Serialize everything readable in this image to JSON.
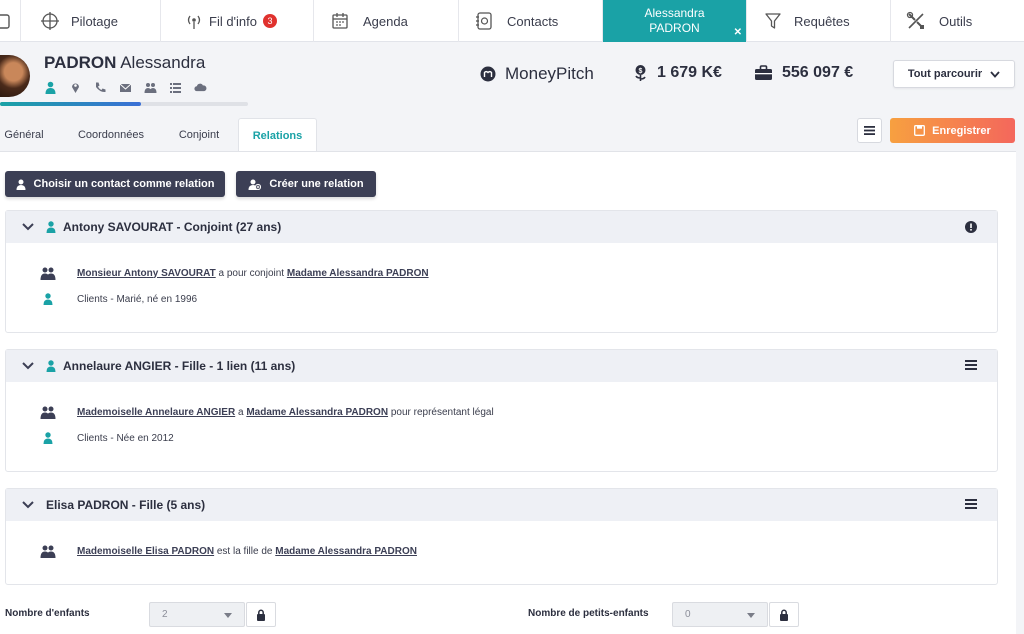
{
  "nav": {
    "items": [
      {
        "label": "Pilotage",
        "icon": "crosshair-icon"
      },
      {
        "label": "Fil d'info",
        "icon": "broadcast-icon",
        "badge": "3"
      },
      {
        "label": "Agenda",
        "icon": "calendar-icon"
      },
      {
        "label": "Contacts",
        "icon": "address-book-icon"
      },
      {
        "label_line1": "Alessandra",
        "label_line2": "PADRON",
        "active": true
      },
      {
        "label": "Requêtes",
        "icon": "filter-icon"
      },
      {
        "label": "Outils",
        "icon": "tools-icon"
      }
    ]
  },
  "profile": {
    "last_name": "PADRON",
    "first_name": "Alessandra",
    "progress": 0.57
  },
  "header": {
    "moneypitch": "MoneyPitch",
    "stat1": "1 679 K€",
    "stat2": "556 097 €",
    "browse": "Tout parcourir"
  },
  "tabs": [
    "Général",
    "Coordonnées",
    "Conjoint",
    "Relations"
  ],
  "actions": {
    "save": "Enregistrer",
    "choose_contact": "Choisir un contact comme relation",
    "create_relation": "Créer une relation"
  },
  "relations": [
    {
      "title": "Antony SAVOURAT - Conjoint (27 ans)",
      "line1_link1": "Monsieur Antony SAVOURAT",
      "line1_mid": " a pour conjoint ",
      "line1_link2": "Madame Alessandra PADRON",
      "line1_end": "",
      "line2": "Clients - Marié, né en 1996"
    },
    {
      "title": "Annelaure ANGIER - Fille - 1 lien (11 ans)",
      "line1_link1": "Mademoiselle Annelaure ANGIER",
      "line1_mid": " a ",
      "line1_link2": "Madame Alessandra PADRON",
      "line1_end": " pour représentant légal",
      "line2": "Clients - Née en 2012"
    },
    {
      "title": "Elisa PADRON - Fille (5 ans)",
      "line1_link1": "Mademoiselle Elisa PADRON",
      "line1_mid": " est la fille de ",
      "line1_link2": "Madame Alessandra PADRON",
      "line1_end": ""
    }
  ],
  "fields": {
    "children_label": "Nombre d'enfants",
    "children_value": "2",
    "grandchildren_label": "Nombre de petits-enfants",
    "grandchildren_value": "0"
  },
  "colors": {
    "accent": "#1aa2a6",
    "dark_button": "#3c3f55",
    "save_start": "#f7a040",
    "save_end": "#f4675c",
    "badge": "#e0322e"
  }
}
